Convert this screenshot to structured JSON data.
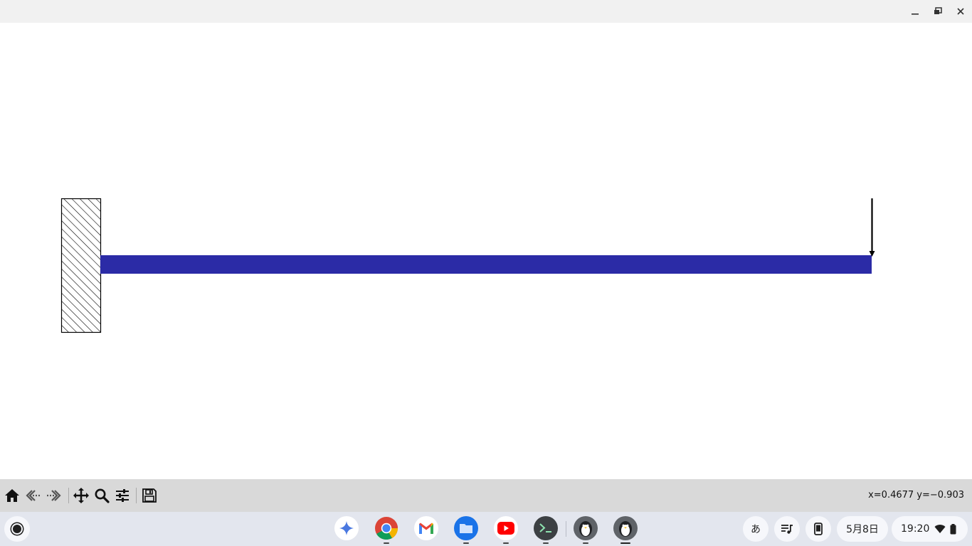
{
  "window": {
    "controls": {
      "minimize_icon": "minimize-icon",
      "restore_icon": "restore-icon",
      "close_icon": "close-icon"
    }
  },
  "figure": {
    "description_elements": [
      "fixed-wall-support",
      "beam",
      "point-load-arrow"
    ],
    "beam_color": "#2b2ba6",
    "wall_hatch_color": "#000000"
  },
  "toolbar": {
    "buttons": [
      {
        "name": "home",
        "icon": "home-icon"
      },
      {
        "name": "back",
        "icon": "back-arrow-icon"
      },
      {
        "name": "forward",
        "icon": "forward-arrow-icon"
      },
      {
        "name": "pan",
        "icon": "move-icon"
      },
      {
        "name": "zoom",
        "icon": "zoom-icon"
      },
      {
        "name": "configure-subplots",
        "icon": "sliders-icon"
      },
      {
        "name": "save",
        "icon": "save-icon"
      }
    ],
    "coordinates": "x=0.4677 y=−0.903"
  },
  "shelf": {
    "apps": [
      {
        "name": "gemini",
        "icon": "gemini-icon"
      },
      {
        "name": "chrome",
        "icon": "chrome-icon"
      },
      {
        "name": "gmail",
        "icon": "gmail-icon"
      },
      {
        "name": "files",
        "icon": "files-icon"
      },
      {
        "name": "youtube",
        "icon": "youtube-icon"
      },
      {
        "name": "terminal",
        "icon": "terminal-icon"
      },
      {
        "name": "linux-app-1",
        "icon": "penguin-icon"
      },
      {
        "name": "linux-app-2",
        "icon": "penguin-icon"
      }
    ],
    "tray": {
      "ime": "あ",
      "date": "5月8日",
      "time": "19:20"
    }
  }
}
